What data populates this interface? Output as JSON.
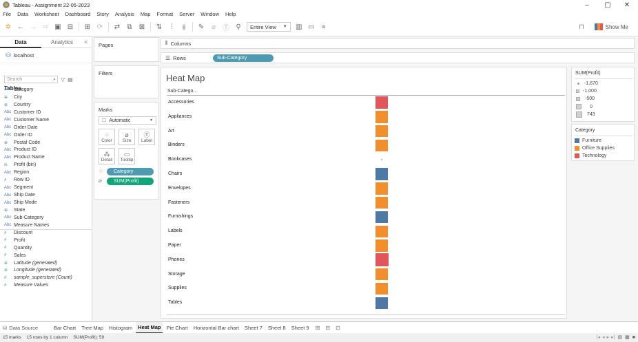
{
  "window": {
    "title": "Tableau - Assignment 22-05-2023",
    "minimize": "–",
    "maximize": "▢",
    "close": "✕"
  },
  "menu": [
    "File",
    "Data",
    "Worksheet",
    "Dashboard",
    "Story",
    "Analysis",
    "Map",
    "Format",
    "Server",
    "Window",
    "Help"
  ],
  "toolbar": {
    "view_mode": "Entire View",
    "show_me": "Show Me"
  },
  "data_pane": {
    "tabs": [
      "Data",
      "Analytics"
    ],
    "collapse": "<",
    "data_source": "localhost",
    "search_placeholder": "Search",
    "tables_heading": "Tables",
    "fields": [
      {
        "type": "Abc",
        "name": "Category"
      },
      {
        "type": "⊕",
        "name": "City"
      },
      {
        "type": "⊕",
        "name": "Country"
      },
      {
        "type": "Abc",
        "name": "Customer ID"
      },
      {
        "type": "Abc",
        "name": "Customer Name"
      },
      {
        "type": "Abc",
        "name": "Order Date"
      },
      {
        "type": "Abc",
        "name": "Order ID"
      },
      {
        "type": "⊕",
        "name": "Postal Code"
      },
      {
        "type": "Abc",
        "name": "Product ID"
      },
      {
        "type": "Abc",
        "name": "Product Name"
      },
      {
        "type": "ılı",
        "name": "Profit (bin)"
      },
      {
        "type": "Abc",
        "name": "Region"
      },
      {
        "type": "#",
        "name": "Row ID"
      },
      {
        "type": "Abc",
        "name": "Segment"
      },
      {
        "type": "Abc",
        "name": "Ship Date"
      },
      {
        "type": "Abc",
        "name": "Ship Mode"
      },
      {
        "type": "⊕",
        "name": "State"
      },
      {
        "type": "Abc",
        "name": "Sub-Category"
      },
      {
        "type": "Abc",
        "name": "Measure Names",
        "italic": true
      },
      {
        "type": "#",
        "name": "Discount",
        "measure": true,
        "sep": true
      },
      {
        "type": "#",
        "name": "Profit",
        "measure": true
      },
      {
        "type": "#",
        "name": "Quantity",
        "measure": true
      },
      {
        "type": "#",
        "name": "Sales",
        "measure": true
      },
      {
        "type": "⊕",
        "name": "Latitude (generated)",
        "measure": true,
        "italic": true
      },
      {
        "type": "⊕",
        "name": "Longitude (generated)",
        "measure": true,
        "italic": true
      },
      {
        "type": "#",
        "name": "sample_superstore (Count)",
        "measure": true,
        "italic": true
      },
      {
        "type": "#",
        "name": "Measure Values",
        "measure": true,
        "italic": true
      }
    ]
  },
  "shelves": {
    "pages": "Pages",
    "filters": "Filters",
    "columns": "Columns",
    "rows": "Rows",
    "rows_pill": "Sub-Category"
  },
  "marks": {
    "title": "Marks",
    "mark_type": "Automatic",
    "buttons": [
      {
        "name": "color",
        "icon": "⁘",
        "label": "Color"
      },
      {
        "name": "size",
        "icon": "⌀",
        "label": "Size"
      },
      {
        "name": "label",
        "icon": "Ⓣ",
        "label": "Label"
      },
      {
        "name": "detail",
        "icon": "⁂",
        "label": "Detail"
      },
      {
        "name": "tooltip",
        "icon": "▭",
        "label": "Tooltip"
      }
    ],
    "pills": [
      {
        "field": "Category",
        "icon": "⁘"
      },
      {
        "field": "SUM(Profit)",
        "icon": "⌀"
      }
    ]
  },
  "chart_data": {
    "type": "heatmap",
    "title": "Heat Map",
    "row_header": "Sub-Catego..",
    "rows": [
      {
        "label": "Accessories",
        "category": "Technology",
        "profit": 420
      },
      {
        "label": "Appliances",
        "category": "Office Supplies",
        "profit": 390
      },
      {
        "label": "Art",
        "category": "Office Supplies",
        "profit": 380
      },
      {
        "label": "Binders",
        "category": "Office Supplies",
        "profit": 330
      },
      {
        "label": "Bookcases",
        "category": "Furniture",
        "profit": -1670
      },
      {
        "label": "Chairs",
        "category": "Furniture",
        "profit": 330
      },
      {
        "label": "Envelopes",
        "category": "Office Supplies",
        "profit": 330
      },
      {
        "label": "Fasteners",
        "category": "Office Supplies",
        "profit": 310
      },
      {
        "label": "Furnishings",
        "category": "Furniture",
        "profit": 330
      },
      {
        "label": "Labels",
        "category": "Office Supplies",
        "profit": 310
      },
      {
        "label": "Paper",
        "category": "Office Supplies",
        "profit": 390
      },
      {
        "label": "Phones",
        "category": "Technology",
        "profit": 743
      },
      {
        "label": "Storage",
        "category": "Office Supplies",
        "profit": 330
      },
      {
        "label": "Supplies",
        "category": "Office Supplies",
        "profit": 330
      },
      {
        "label": "Tables",
        "category": "Furniture",
        "profit": 310
      }
    ],
    "category_colors": {
      "Furniture": "#4e79a7",
      "Office Supplies": "#f28e2b",
      "Technology": "#e15759"
    },
    "size_range": [
      -1670,
      743
    ]
  },
  "legends": {
    "profit": {
      "title": "SUM(Profit)",
      "entries": [
        "-1,670",
        "-1,000",
        "-500",
        "0",
        "743"
      ]
    },
    "category": {
      "title": "Category",
      "entries": [
        {
          "label": "Furniture",
          "color": "#4e79a7"
        },
        {
          "label": "Office Supplies",
          "color": "#f28e2b"
        },
        {
          "label": "Technology",
          "color": "#e15759"
        }
      ]
    }
  },
  "sheet_tabs": {
    "data_source": "Data Source",
    "tabs": [
      "Bar Chart",
      "Tree Map",
      "Histogram",
      "Heat Map",
      "Pie Chart",
      "Horizontal Bar chart",
      "Sheet 7",
      "Sheet 8",
      "Sheet 9"
    ],
    "active": "Heat Map"
  },
  "status": {
    "marks": "15 marks",
    "rows_cols": "15 rows by 1 column",
    "sum": "SUM(Profit): 59"
  }
}
